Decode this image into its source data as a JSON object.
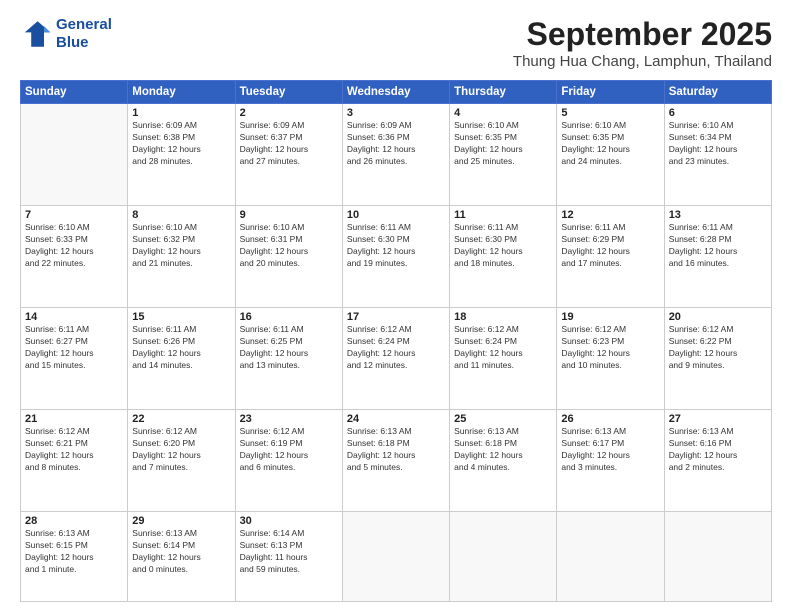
{
  "header": {
    "logo_line1": "General",
    "logo_line2": "Blue",
    "month": "September 2025",
    "location": "Thung Hua Chang, Lamphun, Thailand"
  },
  "days_of_week": [
    "Sunday",
    "Monday",
    "Tuesday",
    "Wednesday",
    "Thursday",
    "Friday",
    "Saturday"
  ],
  "weeks": [
    [
      {
        "num": "",
        "info": ""
      },
      {
        "num": "1",
        "info": "Sunrise: 6:09 AM\nSunset: 6:38 PM\nDaylight: 12 hours\nand 28 minutes."
      },
      {
        "num": "2",
        "info": "Sunrise: 6:09 AM\nSunset: 6:37 PM\nDaylight: 12 hours\nand 27 minutes."
      },
      {
        "num": "3",
        "info": "Sunrise: 6:09 AM\nSunset: 6:36 PM\nDaylight: 12 hours\nand 26 minutes."
      },
      {
        "num": "4",
        "info": "Sunrise: 6:10 AM\nSunset: 6:35 PM\nDaylight: 12 hours\nand 25 minutes."
      },
      {
        "num": "5",
        "info": "Sunrise: 6:10 AM\nSunset: 6:35 PM\nDaylight: 12 hours\nand 24 minutes."
      },
      {
        "num": "6",
        "info": "Sunrise: 6:10 AM\nSunset: 6:34 PM\nDaylight: 12 hours\nand 23 minutes."
      }
    ],
    [
      {
        "num": "7",
        "info": "Sunrise: 6:10 AM\nSunset: 6:33 PM\nDaylight: 12 hours\nand 22 minutes."
      },
      {
        "num": "8",
        "info": "Sunrise: 6:10 AM\nSunset: 6:32 PM\nDaylight: 12 hours\nand 21 minutes."
      },
      {
        "num": "9",
        "info": "Sunrise: 6:10 AM\nSunset: 6:31 PM\nDaylight: 12 hours\nand 20 minutes."
      },
      {
        "num": "10",
        "info": "Sunrise: 6:11 AM\nSunset: 6:30 PM\nDaylight: 12 hours\nand 19 minutes."
      },
      {
        "num": "11",
        "info": "Sunrise: 6:11 AM\nSunset: 6:30 PM\nDaylight: 12 hours\nand 18 minutes."
      },
      {
        "num": "12",
        "info": "Sunrise: 6:11 AM\nSunset: 6:29 PM\nDaylight: 12 hours\nand 17 minutes."
      },
      {
        "num": "13",
        "info": "Sunrise: 6:11 AM\nSunset: 6:28 PM\nDaylight: 12 hours\nand 16 minutes."
      }
    ],
    [
      {
        "num": "14",
        "info": "Sunrise: 6:11 AM\nSunset: 6:27 PM\nDaylight: 12 hours\nand 15 minutes."
      },
      {
        "num": "15",
        "info": "Sunrise: 6:11 AM\nSunset: 6:26 PM\nDaylight: 12 hours\nand 14 minutes."
      },
      {
        "num": "16",
        "info": "Sunrise: 6:11 AM\nSunset: 6:25 PM\nDaylight: 12 hours\nand 13 minutes."
      },
      {
        "num": "17",
        "info": "Sunrise: 6:12 AM\nSunset: 6:24 PM\nDaylight: 12 hours\nand 12 minutes."
      },
      {
        "num": "18",
        "info": "Sunrise: 6:12 AM\nSunset: 6:24 PM\nDaylight: 12 hours\nand 11 minutes."
      },
      {
        "num": "19",
        "info": "Sunrise: 6:12 AM\nSunset: 6:23 PM\nDaylight: 12 hours\nand 10 minutes."
      },
      {
        "num": "20",
        "info": "Sunrise: 6:12 AM\nSunset: 6:22 PM\nDaylight: 12 hours\nand 9 minutes."
      }
    ],
    [
      {
        "num": "21",
        "info": "Sunrise: 6:12 AM\nSunset: 6:21 PM\nDaylight: 12 hours\nand 8 minutes."
      },
      {
        "num": "22",
        "info": "Sunrise: 6:12 AM\nSunset: 6:20 PM\nDaylight: 12 hours\nand 7 minutes."
      },
      {
        "num": "23",
        "info": "Sunrise: 6:12 AM\nSunset: 6:19 PM\nDaylight: 12 hours\nand 6 minutes."
      },
      {
        "num": "24",
        "info": "Sunrise: 6:13 AM\nSunset: 6:18 PM\nDaylight: 12 hours\nand 5 minutes."
      },
      {
        "num": "25",
        "info": "Sunrise: 6:13 AM\nSunset: 6:18 PM\nDaylight: 12 hours\nand 4 minutes."
      },
      {
        "num": "26",
        "info": "Sunrise: 6:13 AM\nSunset: 6:17 PM\nDaylight: 12 hours\nand 3 minutes."
      },
      {
        "num": "27",
        "info": "Sunrise: 6:13 AM\nSunset: 6:16 PM\nDaylight: 12 hours\nand 2 minutes."
      }
    ],
    [
      {
        "num": "28",
        "info": "Sunrise: 6:13 AM\nSunset: 6:15 PM\nDaylight: 12 hours\nand 1 minute."
      },
      {
        "num": "29",
        "info": "Sunrise: 6:13 AM\nSunset: 6:14 PM\nDaylight: 12 hours\nand 0 minutes."
      },
      {
        "num": "30",
        "info": "Sunrise: 6:14 AM\nSunset: 6:13 PM\nDaylight: 11 hours\nand 59 minutes."
      },
      {
        "num": "",
        "info": ""
      },
      {
        "num": "",
        "info": ""
      },
      {
        "num": "",
        "info": ""
      },
      {
        "num": "",
        "info": ""
      }
    ]
  ]
}
